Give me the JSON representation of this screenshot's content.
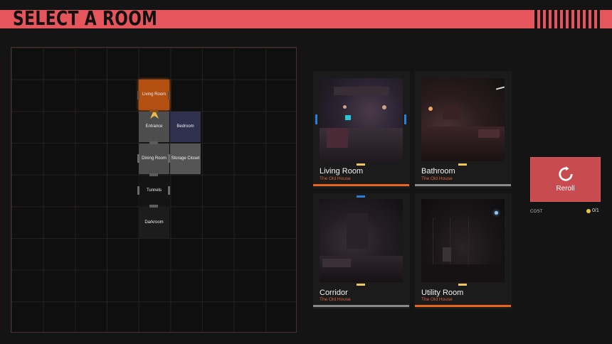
{
  "header": {
    "title": "SELECT A ROOM"
  },
  "map": {
    "rooms": [
      {
        "name": "Living Room",
        "color": "#b44f12"
      },
      {
        "name": "Entrance",
        "color": "#4d4d4d"
      },
      {
        "name": "Bedroom",
        "color": "#2f2f4e"
      },
      {
        "name": "Dining Room",
        "color": "#4d4d4d"
      },
      {
        "name": "Storage Closet",
        "color": "#555555"
      },
      {
        "name": "Tunnels",
        "color": "#141414"
      },
      {
        "name": "Darkroom",
        "color": "#1c1c1c"
      }
    ]
  },
  "cards": [
    {
      "name": "Living Room",
      "subtitle": "The Old House",
      "bar_color": "#e8651c"
    },
    {
      "name": "Bathroom",
      "subtitle": "The Old House",
      "bar_color": "#8a8a8a"
    },
    {
      "name": "Corridor",
      "subtitle": "The Old House",
      "bar_color": "#8a8a8a"
    },
    {
      "name": "Utility Room",
      "subtitle": "The Old House",
      "bar_color": "#e8651c"
    }
  ],
  "reroll": {
    "label": "Reroll",
    "cost_label": "COST",
    "cost_value": "0/1"
  },
  "colors": {
    "accent": "#e5555c",
    "pip": "#f1c75b",
    "selection": "#2b7fd6"
  }
}
